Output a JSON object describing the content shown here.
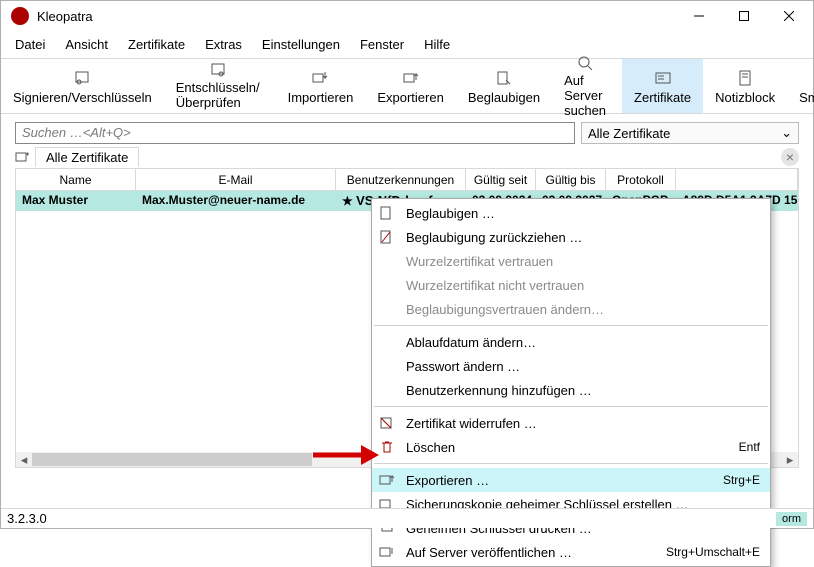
{
  "window": {
    "title": "Kleopatra"
  },
  "menu": [
    "Datei",
    "Ansicht",
    "Zertifikate",
    "Extras",
    "Einstellungen",
    "Fenster",
    "Hilfe"
  ],
  "toolbar": {
    "sign": "Signieren/Verschlüsseln",
    "decrypt": "Entschlüsseln/Überprüfen",
    "import": "Importieren",
    "export": "Exportieren",
    "certify": "Beglaubigen",
    "lookup": "Auf Server suchen",
    "certs": "Zertifikate",
    "notes": "Notizblock",
    "cards": "Smartcards"
  },
  "search": {
    "placeholder": "Suchen …<Alt+Q>",
    "filter": "Alle Zertifikate"
  },
  "tabs": {
    "label": "Alle Zertifikate"
  },
  "columns": [
    "Name",
    "E-Mail",
    "Benutzerkennungen",
    "Gültig seit",
    "Gültig bis",
    "Protokoll",
    ""
  ],
  "row": {
    "name": "Max Muster",
    "email": "Max.Muster@neuer-name.de",
    "userid": "VS-NfD-konform",
    "since": "03.09.2024",
    "until": "03.09.2027",
    "proto": "OpenPGP",
    "fpr": "A89D D5A1 3A7D 15"
  },
  "ctx": {
    "certify": "Beglaubigen …",
    "revoke_cert": "Beglaubigung zurückziehen …",
    "trust_root": "Wurzelzertifikat vertrauen",
    "distrust_root": "Wurzelzertifikat nicht vertrauen",
    "change_trust": "Beglaubigungsvertrauen ändern…",
    "change_expiry": "Ablaufdatum ändern…",
    "change_pass": "Passwort ändern …",
    "add_uid": "Benutzerkennung hinzufügen …",
    "revoke": "Zertifikat widerrufen …",
    "delete": "Löschen",
    "delete_sc": "Entf",
    "export": "Exportieren …",
    "export_sc": "Strg+E",
    "backup": "Sicherungskopie geheimer Schlüssel erstellen …",
    "print": "Geheimen Schlüssel drucken …",
    "publish": "Auf Server veröffentlichen …",
    "publish_sc": "Strg+Umschalt+E"
  },
  "status": {
    "version": "3.2.3.0",
    "tag": "orm"
  }
}
